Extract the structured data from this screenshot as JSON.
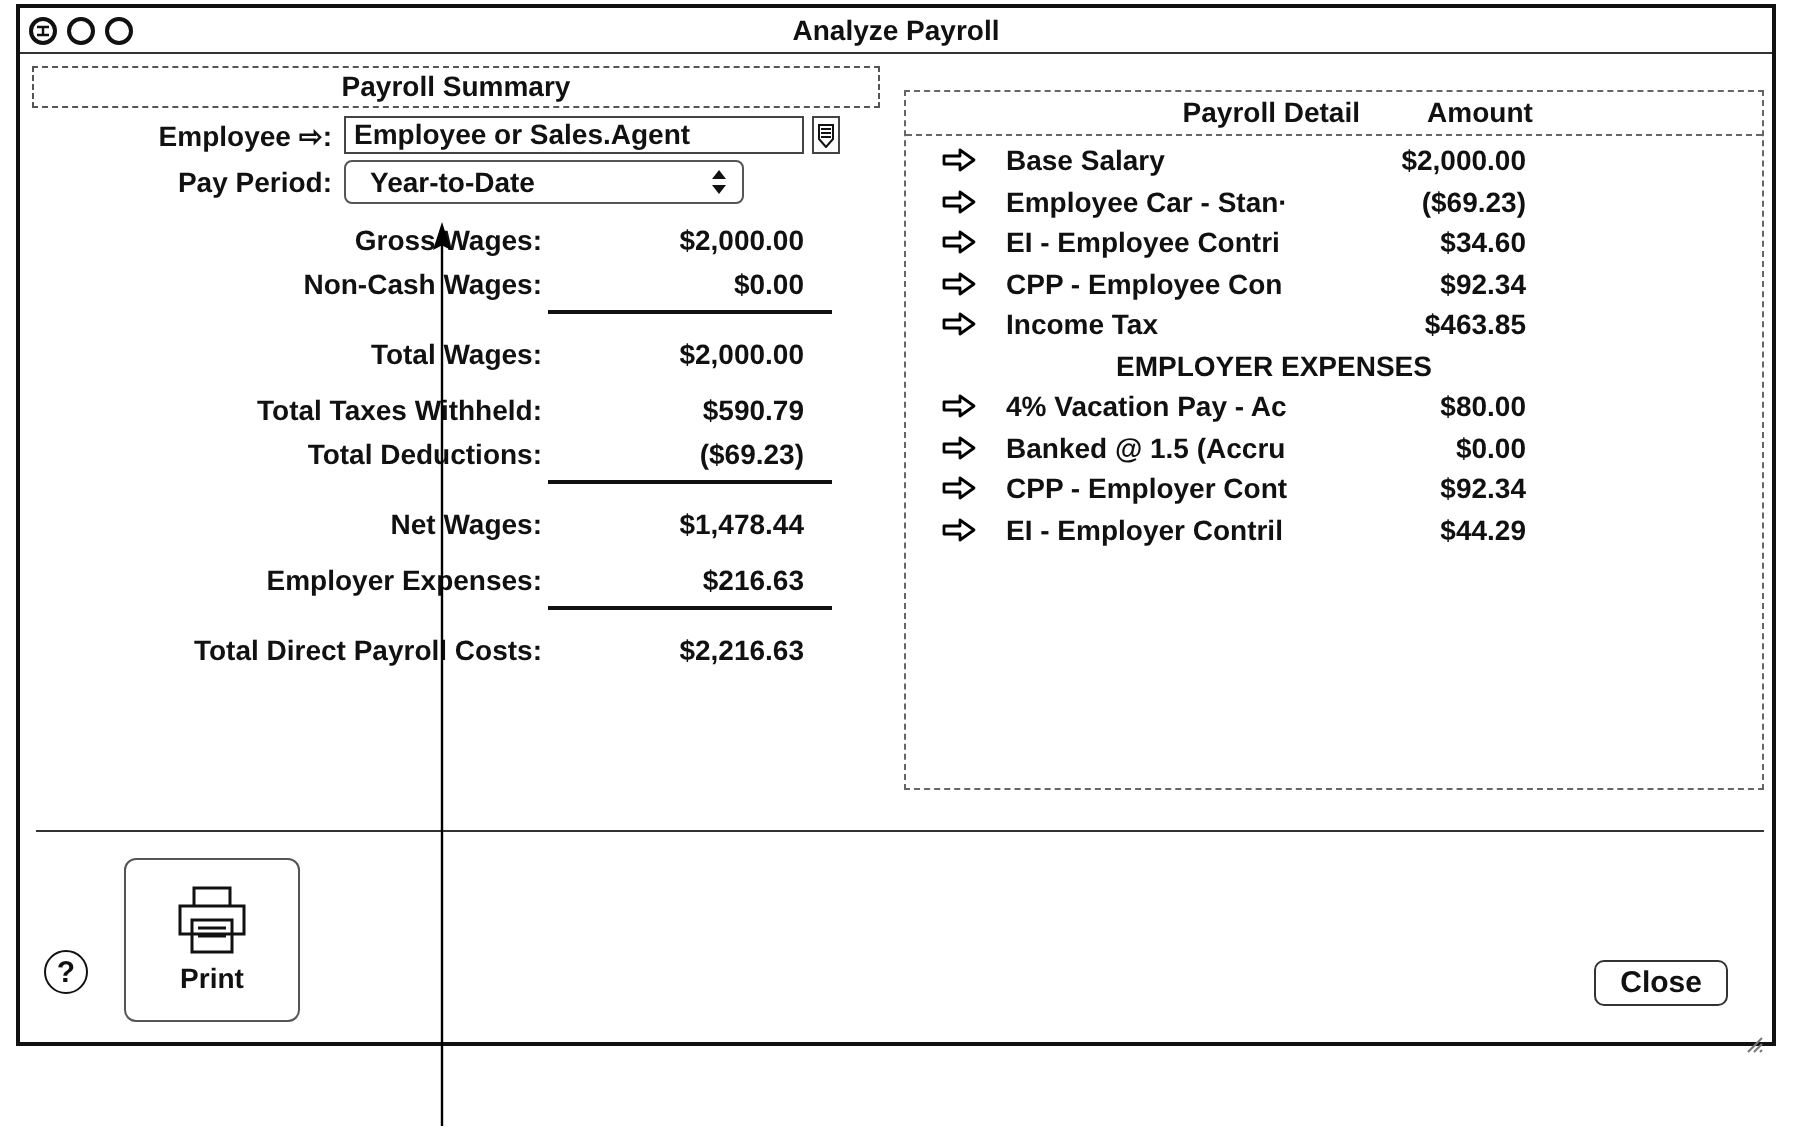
{
  "window": {
    "title": "Analyze Payroll"
  },
  "summary": {
    "title": "Payroll Summary",
    "employee_label": "Employee ⇨:",
    "employee_value": "Employee or Sales.Agent",
    "pay_period_label": "Pay Period:",
    "pay_period_value": "Year-to-Date",
    "groups": [
      [
        {
          "label": "Gross Wages:",
          "value": "$2,000.00",
          "underlined": false
        },
        {
          "label": "Non-Cash Wages:",
          "value": "$0.00",
          "underlined": true
        }
      ],
      [
        {
          "label": "Total Wages:",
          "value": "$2,000.00",
          "underlined": false
        }
      ],
      [
        {
          "label": "Total Taxes Withheld:",
          "value": "$590.79",
          "underlined": false
        },
        {
          "label": "Total Deductions:",
          "value": "($69.23)",
          "underlined": true
        }
      ],
      [
        {
          "label": "Net Wages:",
          "value": "$1,478.44",
          "underlined": false
        }
      ],
      [
        {
          "label": "Employer Expenses:",
          "value": "$216.63",
          "underlined": true
        }
      ],
      [
        {
          "label": "Total Direct Payroll Costs:",
          "value": "$2,216.63",
          "underlined": false
        }
      ]
    ]
  },
  "detail": {
    "columns": [
      "Payroll Detail",
      "Amount"
    ],
    "rows": [
      {
        "kind": "item",
        "name": "Base Salary",
        "amount": "$2,000.00"
      },
      {
        "kind": "item",
        "name": "Employee Car - Stan·",
        "amount": "($69.23)"
      },
      {
        "kind": "item",
        "name": "EI - Employee Contri",
        "amount": "$34.60"
      },
      {
        "kind": "item",
        "name": "CPP - Employee Con",
        "amount": "$92.34"
      },
      {
        "kind": "item",
        "name": "Income Tax",
        "amount": "$463.85"
      },
      {
        "kind": "heading",
        "name": "EMPLOYER EXPENSES"
      },
      {
        "kind": "item",
        "name": "4% Vacation Pay - Ac",
        "amount": "$80.00"
      },
      {
        "kind": "item",
        "name": "Banked @ 1.5 (Accru",
        "amount": "$0.00"
      },
      {
        "kind": "item",
        "name": "CPP - Employer Cont",
        "amount": "$92.34"
      },
      {
        "kind": "item",
        "name": "EI - Employer Contril",
        "amount": "$44.29"
      }
    ]
  },
  "buttons": {
    "help": "?",
    "print": "Print",
    "close": "Close"
  }
}
